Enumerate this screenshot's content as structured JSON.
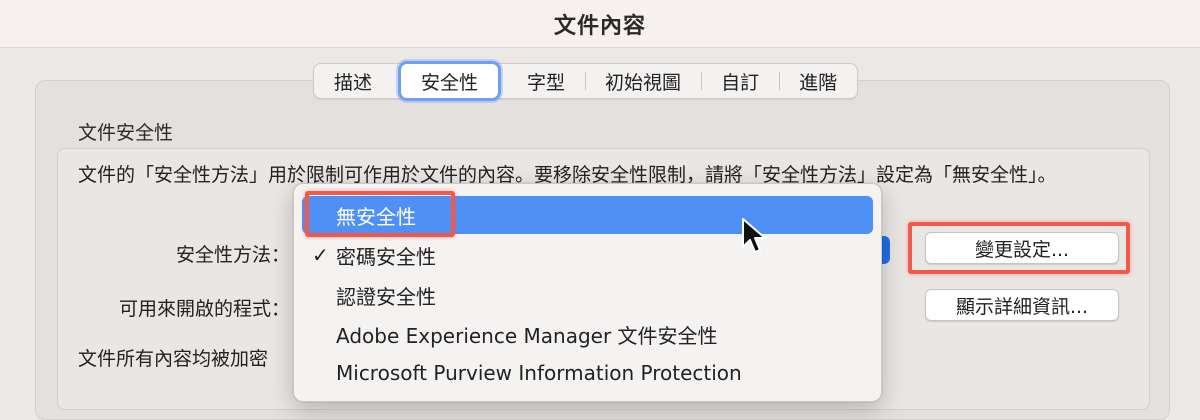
{
  "window": {
    "title": "文件內容"
  },
  "tabs": [
    {
      "label": "描述",
      "selected": false
    },
    {
      "label": "安全性",
      "selected": true
    },
    {
      "label": "字型",
      "selected": false
    },
    {
      "label": "初始視圖",
      "selected": false
    },
    {
      "label": "自訂",
      "selected": false
    },
    {
      "label": "進階",
      "selected": false
    }
  ],
  "security": {
    "section_title": "文件安全性",
    "description": "文件的「安全性方法」用於限制可作用於文件的內容。要移除安全性限制，請將「安全性方法」設定為「無安全性」。",
    "method_label": "安全性方法：",
    "open_with_label": "可用來開啟的程式：",
    "encrypted_text": "文件所有內容均被加密",
    "change_button": "變更設定...",
    "details_button": "顯示詳細資訊..."
  },
  "menu": {
    "items": [
      {
        "label": "無安全性",
        "highlighted": true,
        "checked": false
      },
      {
        "label": "密碼安全性",
        "highlighted": false,
        "checked": true
      },
      {
        "label": "認證安全性",
        "highlighted": false,
        "checked": false
      },
      {
        "label": "Adobe Experience Manager 文件安全性",
        "highlighted": false,
        "checked": false
      },
      {
        "label": "Microsoft Purview Information Protection",
        "highlighted": false,
        "checked": false
      }
    ],
    "check_glyph": "✓"
  },
  "colors": {
    "accent": "#4e90f5",
    "annotation": "#ef5a4c",
    "selected_tab_ring": "#6f9ff0"
  },
  "icons": {
    "cursor": "arrow-cursor-icon"
  }
}
